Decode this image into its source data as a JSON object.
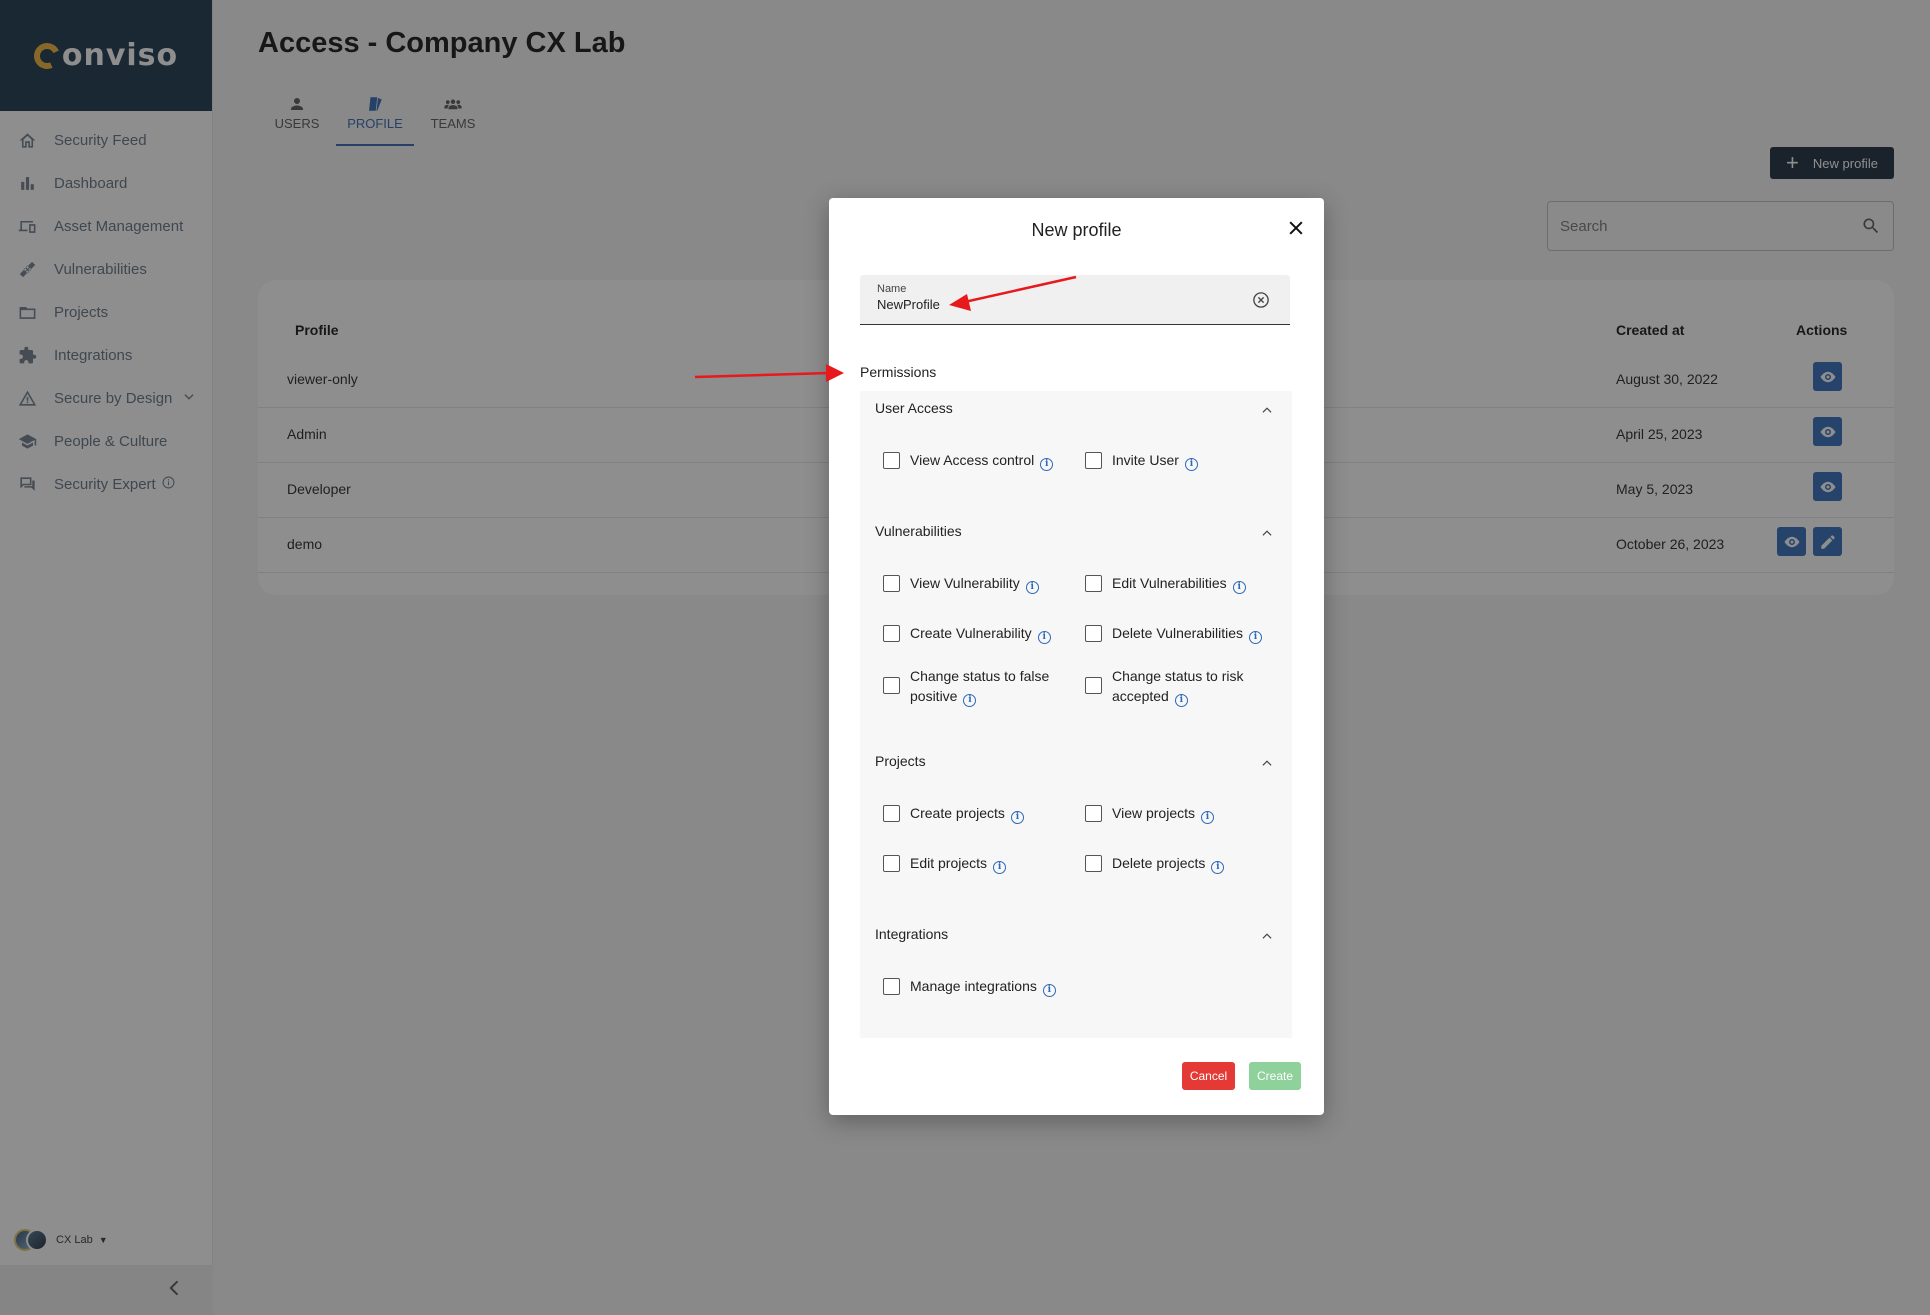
{
  "sidebar": {
    "brand": "onviso",
    "items": [
      {
        "label": "Security Feed",
        "icon": "home-icon"
      },
      {
        "label": "Dashboard",
        "icon": "bar-chart-icon"
      },
      {
        "label": "Asset Management",
        "icon": "devices-icon"
      },
      {
        "label": "Vulnerabilities",
        "icon": "bandage-icon"
      },
      {
        "label": "Projects",
        "icon": "folder-icon"
      },
      {
        "label": "Integrations",
        "icon": "puzzle-icon"
      },
      {
        "label": "Secure by Design",
        "icon": "warning-icon"
      },
      {
        "label": "People & Culture",
        "icon": "school-icon"
      },
      {
        "label": "Security Expert",
        "icon": "chat-icon"
      }
    ],
    "org_label": "CX Lab"
  },
  "page": {
    "title": "Access - Company CX Lab",
    "tabs": [
      {
        "label": "USERS",
        "icon": "person-icon",
        "active": false
      },
      {
        "label": "PROFILE",
        "icon": "badge-icon",
        "active": true
      },
      {
        "label": "TEAMS",
        "icon": "group-icon",
        "active": false
      }
    ],
    "new_profile_label": "New profile",
    "search_placeholder": "Search"
  },
  "table": {
    "headers": {
      "profile": "Profile",
      "created": "Created at",
      "actions": "Actions"
    },
    "rows": [
      {
        "name": "viewer-only",
        "created": "August 30, 2022",
        "editable": false
      },
      {
        "name": "Admin",
        "created": "April 25, 2023",
        "editable": false
      },
      {
        "name": "Developer",
        "created": "May 5, 2023",
        "editable": false
      },
      {
        "name": "demo",
        "created": "October 26, 2023",
        "editable": true
      }
    ]
  },
  "dialog": {
    "title": "New profile",
    "name_label": "Name",
    "name_value": "NewProfile",
    "permissions_label": "Permissions",
    "sections": {
      "user_access": {
        "title": "User Access",
        "items": [
          "View Access control",
          "Invite User"
        ]
      },
      "vulnerabilities": {
        "title": "Vulnerabilities",
        "items": [
          "View Vulnerability",
          "Edit Vulnerabilities",
          "Create Vulnerability",
          "Delete Vulnerabilities",
          "Change status to false positive",
          "Change status to risk accepted"
        ]
      },
      "projects": {
        "title": "Projects",
        "items": [
          "Create projects",
          "View projects",
          "Edit projects",
          "Delete projects"
        ]
      },
      "integrations": {
        "title": "Integrations",
        "items": [
          "Manage integrations"
        ]
      }
    },
    "cancel_label": "Cancel",
    "create_label": "Create"
  },
  "colors": {
    "brand_bg": "#17324a",
    "primary": "#2d69b8",
    "cancel": "#e53935",
    "create_disabled": "#8fd19a",
    "annotation_arrow": "#e8191c"
  }
}
